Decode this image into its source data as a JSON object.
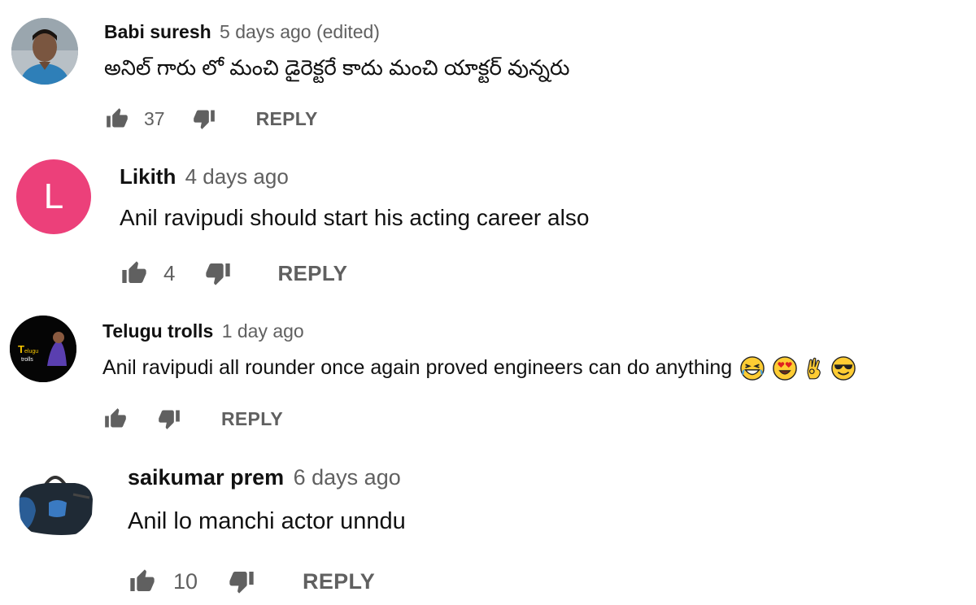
{
  "comments": [
    {
      "author": "Babi suresh",
      "time": "5 days ago (edited)",
      "text": "అనిల్ గారు లో మంచి డైరెక్టరే కాదు మంచి యాక్టర్ వున్నరు",
      "likes": "37",
      "reply_label": "REPLY",
      "avatar": "person-photo"
    },
    {
      "author": "Likith",
      "time": "4 days ago",
      "text": "Anil ravipudi should start his acting career also",
      "likes": "4",
      "reply_label": "REPLY",
      "avatar_letter": "L",
      "avatar_color": "#ec407a"
    },
    {
      "author": "Telugu trolls",
      "time": "1 day ago",
      "text": "Anil ravipudi all rounder once again proved engineers can do anything",
      "likes": "",
      "reply_label": "REPLY",
      "emojis": [
        "grinning-squinting-face",
        "heart-eyes-face",
        "ok-hand",
        "smiling-face-with-sunglasses"
      ],
      "avatar": "channel-logo"
    },
    {
      "author": "saikumar prem",
      "time": "6 days ago",
      "text": "Anil lo manchi actor unndu",
      "likes": "10",
      "reply_label": "REPLY",
      "avatar": "bag-photo"
    }
  ],
  "colors": {
    "meta_gray": "#606060",
    "text": "#111111",
    "avatar_pink": "#ec407a"
  }
}
